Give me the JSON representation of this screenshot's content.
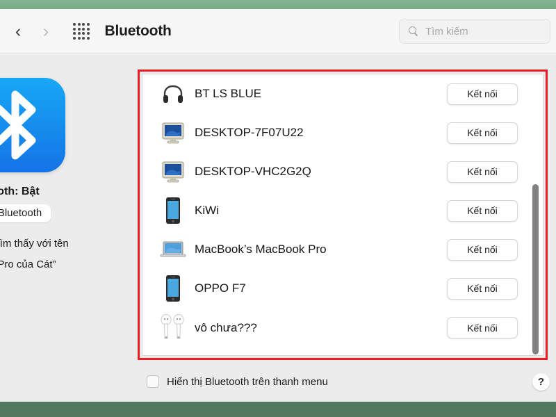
{
  "window": {
    "accent_green": "#5a8068",
    "highlight_color": "#ec1c24",
    "background": "#ececed"
  },
  "toolbar": {
    "back_icon": "chevron-left-icon",
    "forward_icon": "chevron-right-icon",
    "grid_icon": "apps-grid-icon",
    "title": "Bluetooth"
  },
  "search": {
    "icon": "search-icon",
    "placeholder": "Tìm kiếm",
    "value": ""
  },
  "sidebar": {
    "logo_icon": "bluetooth-logo-icon",
    "status_title": "luetooth: Bật",
    "toggle_button": "Tắt Bluetooth",
    "description_line1": "ó thể tìm thấy với tên",
    "description_line2": "Book Pro của Cát”"
  },
  "device_list": {
    "connect_label": "Kết nối",
    "devices": [
      {
        "name": "BT LS BLUE",
        "icon": "headphones-icon",
        "action": "Kết nối"
      },
      {
        "name": "DESKTOP-7F07U22",
        "icon": "desktop-monitor-icon",
        "action": "Kết nối"
      },
      {
        "name": "DESKTOP-VHC2G2Q",
        "icon": "desktop-monitor-icon",
        "action": "Kết nối"
      },
      {
        "name": "KiWi",
        "icon": "smartphone-icon",
        "action": "Kết nối"
      },
      {
        "name": "MacBook’s MacBook Pro",
        "icon": "laptop-icon",
        "action": "Kết nối"
      },
      {
        "name": "OPPO F7",
        "icon": "smartphone-icon",
        "action": "Kết nối"
      },
      {
        "name": "vô chưa???",
        "icon": "airpods-icon",
        "action": "Kết nối"
      }
    ],
    "scrollbar": "vertical-scrollbar"
  },
  "footer": {
    "checkbox_label": "Hiển thị Bluetooth trên thanh menu",
    "checkbox_checked": false,
    "help_label": "?"
  }
}
